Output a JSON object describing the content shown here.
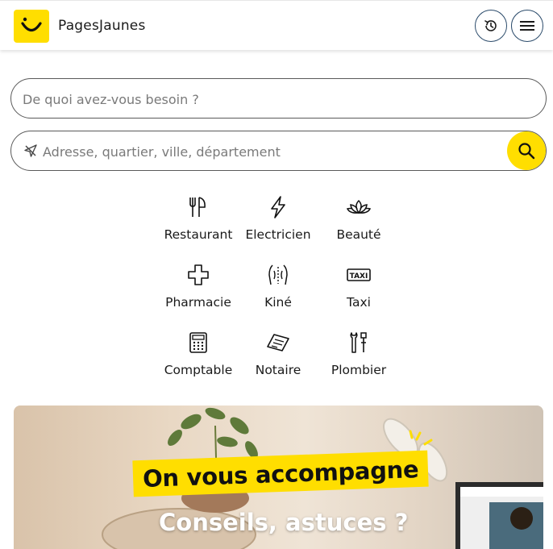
{
  "header": {
    "logo_text": "PagesJaunes"
  },
  "search": {
    "what_placeholder": "De quoi avez-vous besoin ?",
    "where_placeholder": "Adresse, quartier, ville, département"
  },
  "categories": [
    {
      "label": "Restaurant",
      "icon": "utensils-icon"
    },
    {
      "label": "Electricien",
      "icon": "lightning-icon"
    },
    {
      "label": "Beauté",
      "icon": "lotus-icon"
    },
    {
      "label": "Pharmacie",
      "icon": "cross-icon"
    },
    {
      "label": "Kiné",
      "icon": "back-body-icon"
    },
    {
      "label": "Taxi",
      "icon": "taxi-sign-icon"
    },
    {
      "label": "Comptable",
      "icon": "calculator-icon"
    },
    {
      "label": "Notaire",
      "icon": "document-stamp-icon"
    },
    {
      "label": "Plombier",
      "icon": "tools-icon"
    }
  ],
  "banner": {
    "title": "On vous accompagne",
    "subtitle": "Conseils, astuces ?"
  },
  "colors": {
    "brand_yellow": "#ffde00",
    "button_border": "#2a4a6a"
  }
}
